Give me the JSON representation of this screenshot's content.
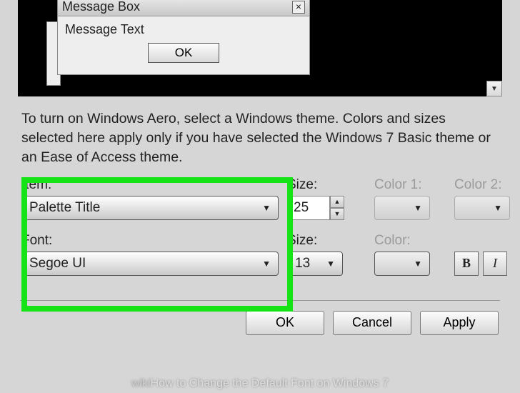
{
  "preview": {
    "msgbox_title": "Message Box",
    "msgbox_text": "Message Text",
    "ok_label": "OK"
  },
  "instructions": "To turn on Windows Aero, select a Windows theme.  Colors and sizes selected here apply only if you have selected the Windows 7 Basic theme or an Ease of Access theme.",
  "labels": {
    "item": "Item:",
    "size1": "Size:",
    "color1": "Color 1:",
    "color2": "Color 2:",
    "font": "Font:",
    "size2": "Size:",
    "colorf": "Color:"
  },
  "values": {
    "item": "Palette Title",
    "size1": "25",
    "font": "Segoe UI",
    "size2": "13"
  },
  "style_buttons": {
    "bold": "B",
    "italic": "I"
  },
  "buttons": {
    "ok": "OK",
    "cancel": "Cancel",
    "apply": "Apply"
  },
  "watermark": {
    "prefix": "wiki",
    "how": "How to ",
    "title": "Change the Default Font on Windows 7"
  }
}
